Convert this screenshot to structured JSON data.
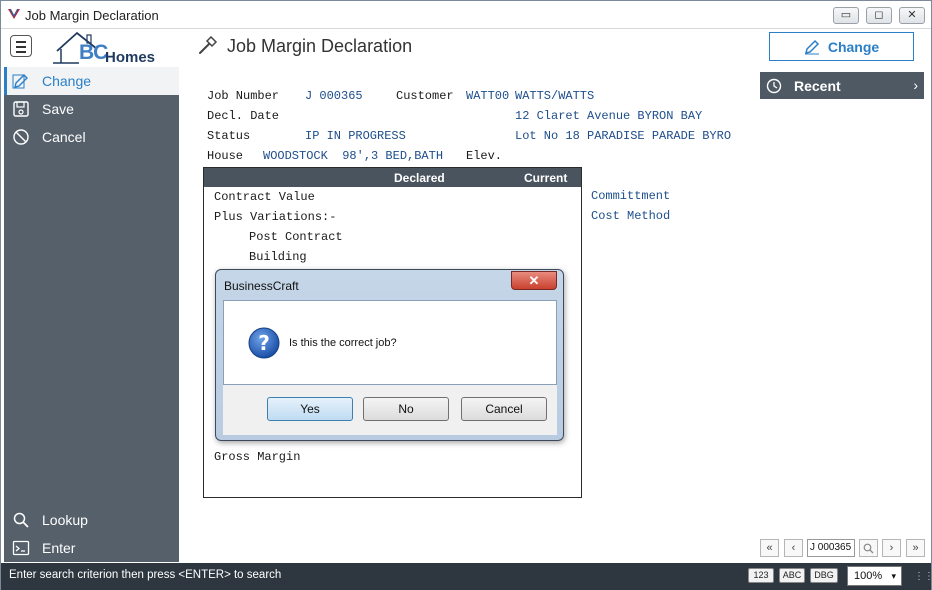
{
  "window": {
    "title": "Job Margin Declaration",
    "controls": {
      "minimize": "▭",
      "maximize": "◻",
      "close": "✕"
    }
  },
  "header": {
    "logo_bc": "BC",
    "logo_homes": "Homes",
    "page_title": "Job Margin Declaration",
    "change_button": "Change"
  },
  "sidebar": {
    "top_items": [
      {
        "label": "Change",
        "icon": "edit-icon"
      },
      {
        "label": "Save",
        "icon": "save-icon"
      },
      {
        "label": "Cancel",
        "icon": "cancel-icon"
      }
    ],
    "bottom_items": [
      {
        "label": "Lookup",
        "icon": "search-icon"
      },
      {
        "label": "Enter",
        "icon": "terminal-icon"
      }
    ]
  },
  "recent": {
    "label": "Recent",
    "chevron": "›"
  },
  "form": {
    "job_number_label": "Job Number",
    "job_number": "J 000365",
    "customer_label": "Customer",
    "customer_code": "WATT00",
    "customer_name": "WATTS/WATTS",
    "decl_date_label": "Decl. Date",
    "address_1": "12 Claret Avenue BYRON BAY",
    "status_label": "Status",
    "status_value": "IP IN PROGRESS",
    "address_2": "Lot No 18 PARADISE PARADE BYRO",
    "house_label": "House",
    "house_value": "WOODSTOCK  98',3 BED,BATH",
    "elev_label": "Elev.",
    "commitment_label": "Committment",
    "cost_method_label": "Cost Method"
  },
  "panel": {
    "declared": "Declared",
    "current": "Current",
    "rows": [
      "Contract Value",
      "Plus Variations:-",
      "Post Contract",
      "Building"
    ],
    "gross_margin": "Gross Margin"
  },
  "dialog": {
    "title": "BusinessCraft",
    "close": "✕",
    "message": "Is this the correct job?",
    "yes": "Yes",
    "no": "No",
    "cancel": "Cancel"
  },
  "nav": {
    "first": "«",
    "prev": "‹",
    "current_value": "J 000365",
    "next": "›",
    "last": "»"
  },
  "status_bar": {
    "message": "Enter search criterion then press <ENTER> to search",
    "badge_123": "123",
    "badge_abc": "ABC",
    "badge_dbg": "DBG",
    "zoom": "100%"
  },
  "colors": {
    "accent": "#2a7fc8",
    "sidebar_bg": "#55606b",
    "status_bg": "#2e3740",
    "panel_head_bg": "#4a545e"
  }
}
